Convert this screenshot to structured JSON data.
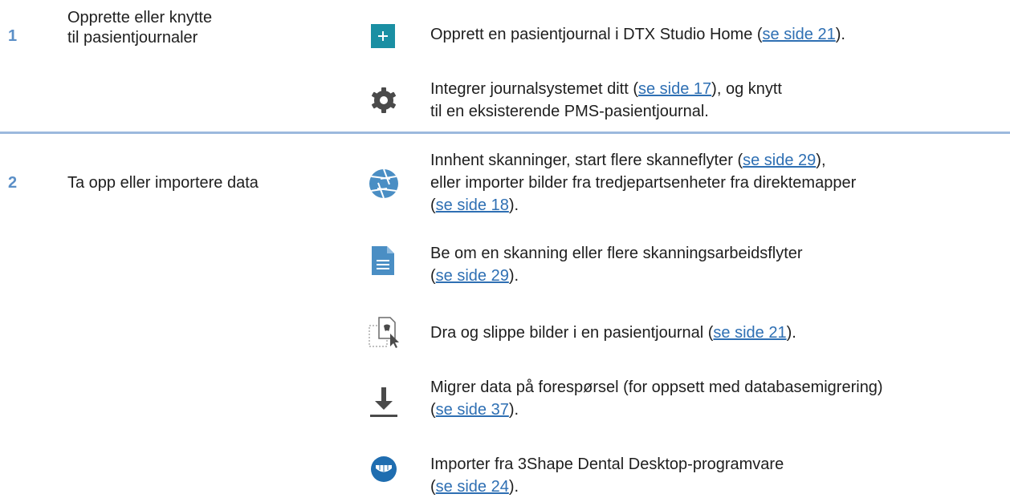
{
  "colors": {
    "accent": "#1a8fa3",
    "link": "#2e6fb3",
    "number": "#5b8fc7",
    "separator": "#9cb9dd",
    "icon_gray": "#4a4a4a"
  },
  "steps": [
    {
      "number": "1",
      "title_line1": "Opprette eller knytte",
      "title_line2": "til pasientjournaler",
      "actions": [
        {
          "icon": "plus-icon",
          "parts": [
            "Opprett en pasientjournal i DTX Studio Home (",
            "se side 21",
            ")."
          ]
        },
        {
          "icon": "gear-icon",
          "line1": [
            "Integrer journalsystemet ditt (",
            "se side 17",
            "), og knytt"
          ],
          "line2": "til en eksisterende PMS-pasientjournal."
        }
      ]
    },
    {
      "number": "2",
      "title": "Ta opp eller importere data",
      "actions": [
        {
          "icon": "aperture-icon",
          "line1": [
            "Innhent skanninger, start flere skanneflyter (",
            "se side 29",
            "),"
          ],
          "line2": "eller importer bilder fra tredjepartsenheter fra direktemapper",
          "line3": [
            "(",
            "se side 18",
            ")."
          ]
        },
        {
          "icon": "document-icon",
          "line1": "Be om en skanning eller flere skanningsarbeidsflyter",
          "line2": [
            "(",
            "se side 29",
            ")."
          ]
        },
        {
          "icon": "drag-drop-icon",
          "parts": [
            "Dra og slippe bilder i en pasientjournal (",
            "se side 21",
            ")."
          ]
        },
        {
          "icon": "download-icon",
          "line1": "Migrer data på forespørsel (for oppsett med databasemigrering)",
          "line2": [
            "(",
            "se side 37",
            ")."
          ]
        },
        {
          "icon": "dental-scan-icon",
          "line1": "Importer fra 3Shape Dental Desktop-programvare",
          "line2": [
            "(",
            "se side 24",
            ")."
          ]
        }
      ]
    }
  ]
}
